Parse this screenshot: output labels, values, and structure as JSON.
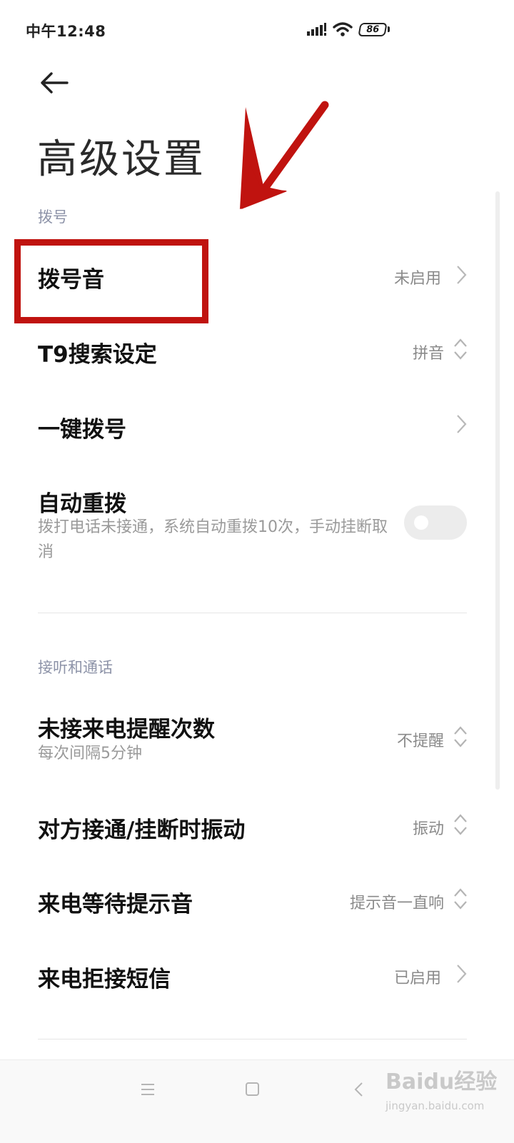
{
  "status_bar": {
    "time": "中午12:48",
    "battery": "86"
  },
  "header": {
    "title": "高级设置"
  },
  "sections": [
    {
      "header": "拨号",
      "rows": [
        {
          "title": "拨号音",
          "value": "未启用"
        },
        {
          "title": "T9搜索设定",
          "value": "拼音"
        },
        {
          "title": "一键拨号",
          "value": ""
        },
        {
          "title": "自动重拨",
          "subtitle": "拨打电话未接通，系统自动重拨10次，手动挂断取消",
          "toggle": false
        }
      ]
    },
    {
      "header": "接听和通话",
      "rows": [
        {
          "title": "未接来电提醒次数",
          "subtitle": "每次间隔5分钟",
          "value": "不提醒"
        },
        {
          "title": "对方接通/挂断时振动",
          "value": "振动"
        },
        {
          "title": "来电等待提示音",
          "value": "提示音一直响"
        },
        {
          "title": "来电拒接短信",
          "value": "已启用"
        }
      ]
    }
  ],
  "watermark": {
    "main": "Baidu经验",
    "sub": "jingyan.baidu.com"
  },
  "colors": {
    "annotation": "#c0130f",
    "section_header": "#8d93a8",
    "secondary_text": "#9a9a9a"
  },
  "icons": [
    "back-arrow-icon",
    "signal-icon",
    "wifi-icon",
    "battery-icon",
    "chevron-right-icon",
    "up-down-icon",
    "menu-icon",
    "home-icon",
    "back-icon"
  ]
}
